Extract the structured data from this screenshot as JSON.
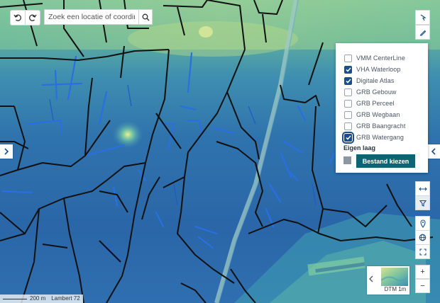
{
  "search": {
    "placeholder": "Zoek een locatie of coordinaten"
  },
  "layers": [
    {
      "label": "VMM CenterLine",
      "checked": false
    },
    {
      "label": "VHA Waterloop",
      "checked": true
    },
    {
      "label": "Digitale Atlas",
      "checked": true
    },
    {
      "label": "GRB Gebouw",
      "checked": false
    },
    {
      "label": "GRB Perceel",
      "checked": false
    },
    {
      "label": "GRB Wegbaan",
      "checked": false
    },
    {
      "label": "GRB Baangracht",
      "checked": false
    },
    {
      "label": "GRB Watergang",
      "checked": true
    }
  ],
  "own_layer": {
    "label": "Eigen laag",
    "button": "Bestand kiezen"
  },
  "basemap": {
    "label": "DTM 1m"
  },
  "scale": {
    "distance": "200 m",
    "projection": "Lambert 72"
  },
  "zoom": {
    "in": "+",
    "out": "−"
  },
  "colors": {
    "accent": "#0e6376",
    "check": "#1a4f8b",
    "water": "#2a6fe0",
    "parcel": "#111111"
  }
}
